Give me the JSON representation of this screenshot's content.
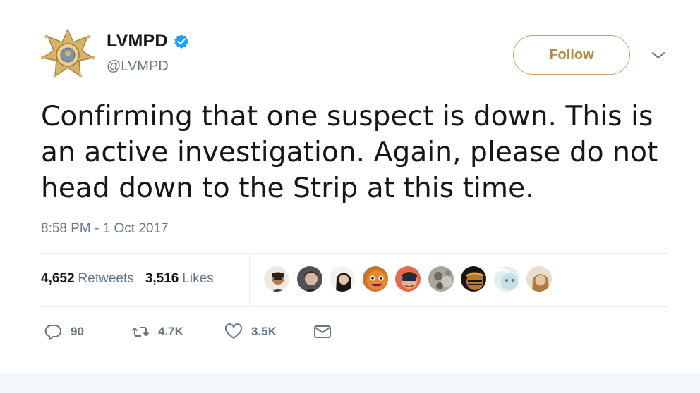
{
  "user": {
    "display_name": "LVMPD",
    "handle": "@LVMPD",
    "verified_icon": "verified-badge-icon",
    "avatar_icon": "police-badge-icon"
  },
  "follow_label": "Follow",
  "tweet": {
    "text_lines": [
      "Confirming that one suspect is down. This is",
      "an active investigation. Again, please do not",
      "head down to the Strip at this time."
    ],
    "timestamp": "8:58 PM - 1 Oct 2017"
  },
  "stats": {
    "retweets_count": "4,652",
    "retweets_label": "Retweets",
    "likes_count": "3,516",
    "likes_label": "Likes"
  },
  "liked_by_avatars": 9,
  "actions": {
    "reply_count": "90",
    "retweet_count": "4.7K",
    "like_count": "3.5K"
  },
  "colors": {
    "follow_accent": "#b48a3c",
    "text_primary": "#14171a",
    "text_secondary": "#657786",
    "verified_blue": "#1da1f2"
  }
}
